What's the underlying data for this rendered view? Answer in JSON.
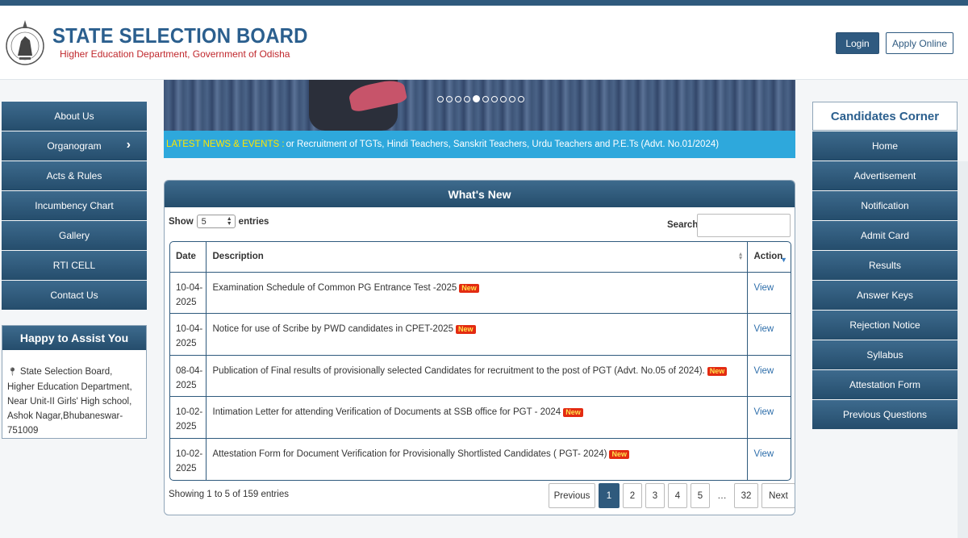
{
  "header": {
    "title": "STATE SELECTION BOARD",
    "subtitle": "Higher Education Department, Government of Odisha",
    "login_label": "Login",
    "apply_label": "Apply Online"
  },
  "left_nav": {
    "items": [
      {
        "label": "About Us"
      },
      {
        "label": "Organogram",
        "has_submenu": true,
        "icon": "chevron-right-icon"
      },
      {
        "label": "Acts & Rules"
      },
      {
        "label": "Incumbency Chart"
      },
      {
        "label": "Gallery"
      },
      {
        "label": "RTI CELL"
      },
      {
        "label": "Contact Us"
      }
    ]
  },
  "assist": {
    "title": "Happy to Assist You",
    "icon": "map-marker-icon",
    "address": "State Selection Board, Higher Education Department, Near Unit-II Girls' High school, Ashok Nagar,Bhubaneswar-751009"
  },
  "banner": {
    "slide_count": 10,
    "active_slide": 5
  },
  "news": {
    "label": "LATEST NEWS & EVENTS :",
    "text": "or Recruitment of TGTs, Hindi Teachers, Sanskrit Teachers, Urdu Teachers and P.E.Ts (Advt. No.01/2024)"
  },
  "whats_new": {
    "title": "What's New",
    "show_label": "Show",
    "entries_value": "5",
    "entries_label": "entries",
    "search_label": "Search:",
    "columns": {
      "date": "Date",
      "description": "Description",
      "action": "Action"
    },
    "new_badge": "New",
    "rows": [
      {
        "date": "10-04-2025",
        "description": "Examination Schedule of Common PG Entrance Test -2025",
        "action": "View"
      },
      {
        "date": "10-04-2025",
        "description": "Notice for use of Scribe by PWD candidates in CPET-2025",
        "action": "View"
      },
      {
        "date": "08-04-2025",
        "description": "Publication of Final results of provisionally selected Candidates for recruitment to the post of PGT (Advt. No.05 of 2024).",
        "action": "View"
      },
      {
        "date": "10-02-2025",
        "description": "Intimation Letter for attending Verification of Documents at SSB office for PGT - 2024",
        "action": "View"
      },
      {
        "date": "10-02-2025",
        "description": "Attestation Form for Document Verification for Provisionally Shortlisted Candidates ( PGT- 2024)",
        "action": "View"
      }
    ],
    "showing_text": "Showing 1 to 5 of 159 entries",
    "pagination": {
      "previous": "Previous",
      "next": "Next",
      "pages": [
        "1",
        "2",
        "3",
        "4",
        "5",
        "…",
        "32"
      ],
      "active": "1"
    }
  },
  "candidates_corner": {
    "title": "Candidates Corner",
    "items": [
      "Home",
      "Advertisement",
      "Notification",
      "Admit Card",
      "Results",
      "Answer Keys",
      "Rejection Notice",
      "Syllabus",
      "Attestation Form",
      "Previous Questions"
    ]
  },
  "colors": {
    "brand_blue": "#2b5f8e",
    "nav_dark": "#254d6c",
    "accent_red": "#c0282d",
    "ticker_bg": "#2ea8dc",
    "ticker_label": "#ffe600"
  }
}
